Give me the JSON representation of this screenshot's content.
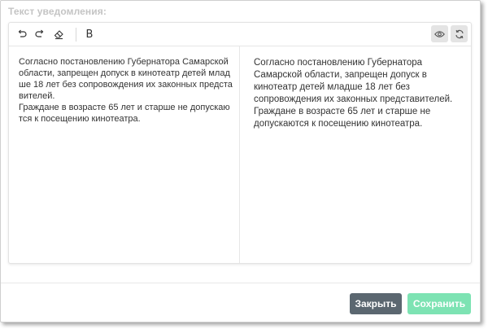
{
  "field_label": "Текст уведомления:",
  "toolbar": {
    "undo_icon": "undo-icon",
    "redo_icon": "redo-icon",
    "clear_format_icon": "eraser-icon",
    "bold_label": "B",
    "preview_icon": "eye-icon",
    "sync_icon": "refresh-icon"
  },
  "editor": {
    "source_text": "Согласно постановлению Губернатора Самарской области, запрещен допуск в кинотеатр детей младше 18 лет без сопровождения их законных представителей.\nГраждане в возрасте 65 лет и старше не допускаются к посещению кинотеатра.",
    "preview_paragraphs": [
      "Согласно постановлению Губернатора Самарской области, запрещен допуск в кинотеатр детей младше 18 лет без сопровождения их законных представителей.",
      "Граждане в возрасте 65 лет и старше не допускаются к посещению кинотеатра."
    ]
  },
  "footer": {
    "close_label": "Закрыть",
    "save_label": "Сохранить"
  },
  "colors": {
    "close_button": "#5b6770",
    "save_button": "#7de3b3",
    "label": "#c4c4c4",
    "text": "#333333"
  }
}
